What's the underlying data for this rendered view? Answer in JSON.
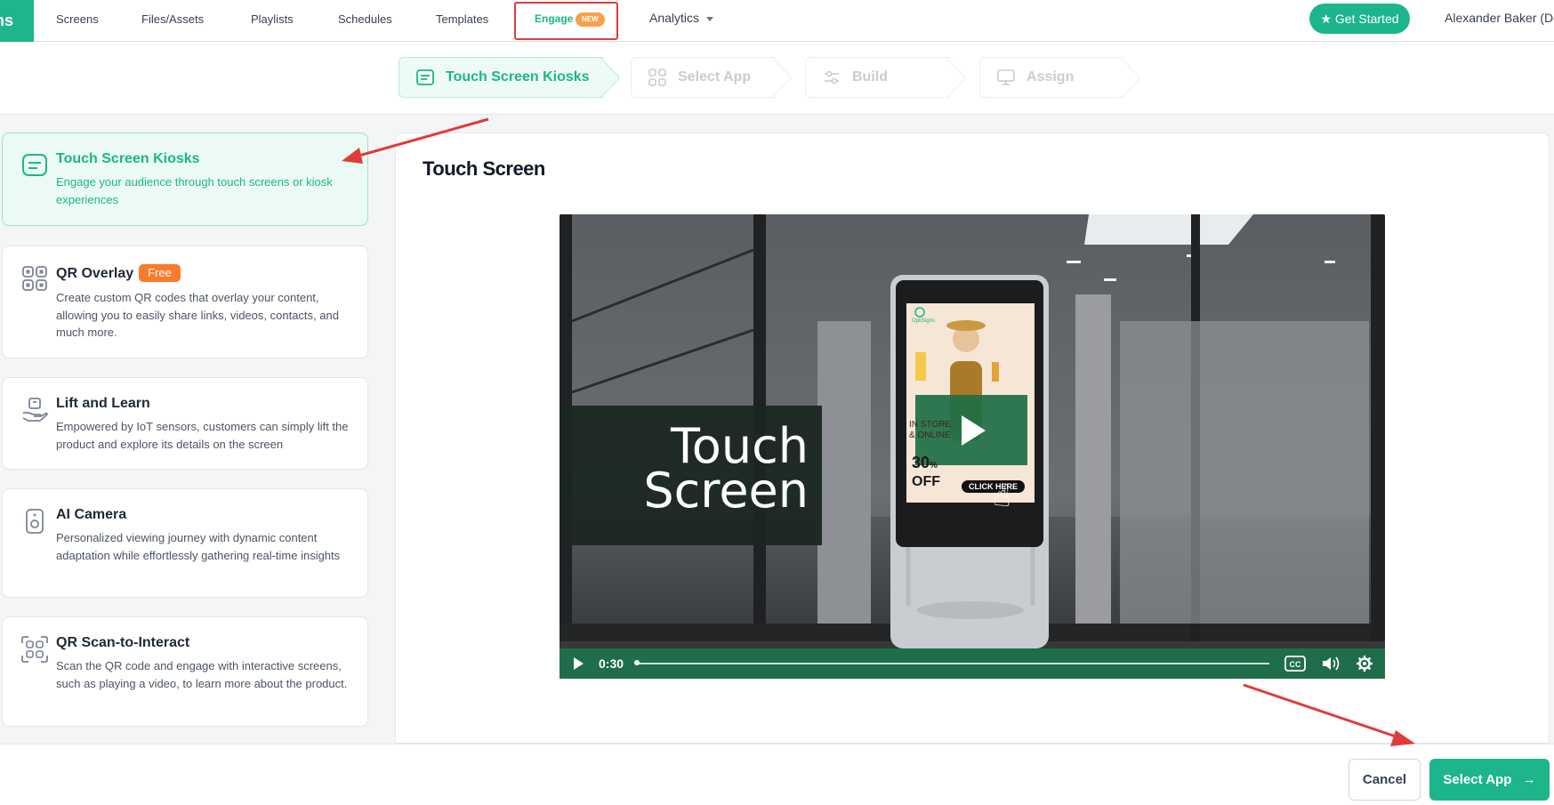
{
  "nav": {
    "logo_fragment": "ns",
    "items": [
      "Screens",
      "Files/Assets",
      "Playlists",
      "Schedules",
      "Templates"
    ],
    "engage": "Engage",
    "engage_badge": "NEW",
    "analytics": "Analytics",
    "get_started": "Get Started",
    "user": "Alexander Baker (De"
  },
  "steps": [
    {
      "label": "Touch Screen Kiosks",
      "icon": "kiosk-icon",
      "state": "active"
    },
    {
      "label": "Select App",
      "icon": "grid-icon",
      "state": "inactive"
    },
    {
      "label": "Build",
      "icon": "sliders-icon",
      "state": "inactive"
    },
    {
      "label": "Assign",
      "icon": "monitor-icon",
      "state": "inactive"
    }
  ],
  "apps": [
    {
      "title": "Touch Screen Kiosks",
      "badge": "",
      "desc": "Engage your audience through touch screens or kiosk experiences",
      "icon": "kiosk-icon"
    },
    {
      "title": "QR Overlay",
      "badge": "Free",
      "desc": "Create custom QR codes that overlay your content, allowing you to easily share links, videos, contacts, and much more.",
      "icon": "qr-icon"
    },
    {
      "title": "Lift and Learn",
      "badge": "",
      "desc": "Empowered by IoT sensors, customers can simply lift the product and explore its details on the screen",
      "icon": "hand-box-icon"
    },
    {
      "title": "AI Camera",
      "badge": "",
      "desc": "Personalized viewing journey with dynamic content adaptation while effortlessly gathering real-time insights",
      "icon": "camera-icon"
    },
    {
      "title": "QR Scan-to-Interact",
      "badge": "",
      "desc": "Scan the QR code and engage with interactive screens, such as playing a video, to learn more about the product.",
      "icon": "qr-scan-icon"
    }
  ],
  "preview": {
    "title": "Touch Screen",
    "video_overlay_line1": "Touch",
    "video_overlay_line2": "Screen",
    "kiosk_brand": "OptiSigns",
    "kiosk_text1": "IN STORE",
    "kiosk_text2": "& ONLINE",
    "kiosk_discount": "30",
    "kiosk_percent": "%",
    "kiosk_off": "OFF",
    "kiosk_cta": "CLICK HERE",
    "time": "0:30",
    "progress": 0.0
  },
  "footer": {
    "cancel": "Cancel",
    "select_app": "Select App"
  },
  "colors": {
    "accent": "#1db58b",
    "annotation": "#e03b3b",
    "free_badge": "#f97b2c",
    "new_badge": "#f7a24b"
  }
}
